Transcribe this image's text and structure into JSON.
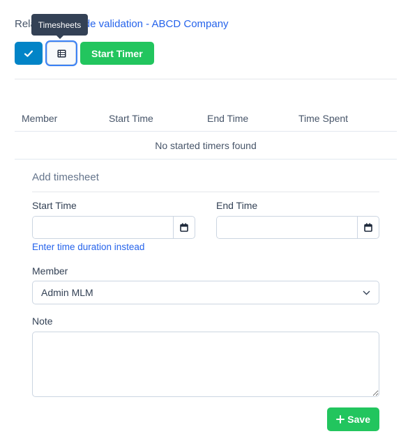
{
  "header": {
    "related_prefix": "Related: ",
    "related_link": "Teste de validation - ABCD Company"
  },
  "tooltip": {
    "text": "Timesheets"
  },
  "toolbar": {
    "check_icon": "check-icon",
    "timesheets_icon": "table-list-icon",
    "start_timer_label": "Start Timer"
  },
  "timers_table": {
    "columns": [
      "Member",
      "Start Time",
      "End Time",
      "Time Spent"
    ],
    "empty_message": "No started timers found"
  },
  "add_timesheet": {
    "title": "Add timesheet",
    "start_time": {
      "label": "Start Time",
      "value": "",
      "icon": "calendar-icon"
    },
    "end_time": {
      "label": "End Time",
      "value": "",
      "icon": "calendar-icon"
    },
    "duration_link": "Enter time duration instead",
    "member": {
      "label": "Member",
      "selected": "Admin MLM",
      "icon": "chevron-down-icon"
    },
    "note": {
      "label": "Note",
      "value": ""
    },
    "save_label": "Save",
    "save_icon": "plus-icon"
  },
  "colors": {
    "primary": "#0284c7",
    "success": "#22c55e",
    "link": "#2563eb",
    "tooltip_bg": "#334155"
  }
}
